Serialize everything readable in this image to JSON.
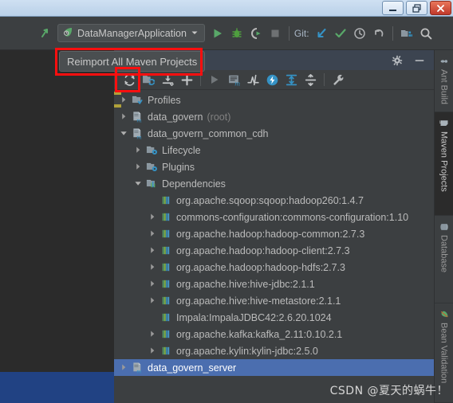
{
  "window": {
    "controls": [
      {
        "name": "minimize-button",
        "glyph": "minimize"
      },
      {
        "name": "restore-button",
        "glyph": "restore"
      },
      {
        "name": "close-button",
        "glyph": "close"
      }
    ]
  },
  "main_toolbar": {
    "back_icon": "back-arrow-icon",
    "run_config": {
      "label": "DataManagerApplication",
      "icon": "spring-boot-icon",
      "dropdown_icon": "chevron-down-icon"
    },
    "actions": [
      {
        "name": "run-button",
        "icon": "run-icon",
        "color": "#5a9e4b"
      },
      {
        "name": "debug-button",
        "icon": "debug-icon",
        "color": "#4f9e3f"
      },
      {
        "name": "run-coverage-button",
        "icon": "coverage-icon",
        "color": "#b8b8b8"
      },
      {
        "name": "stop-button",
        "icon": "stop-icon",
        "color": "#6e7173"
      }
    ],
    "git_label": "Git:",
    "git_actions": [
      {
        "name": "update-project-button",
        "icon": "update-arrow-icon",
        "color": "#3592c4"
      },
      {
        "name": "commit-button",
        "icon": "check-icon",
        "color": "#59a869"
      },
      {
        "name": "history-button",
        "icon": "clock-icon",
        "color": "#afb1b3"
      },
      {
        "name": "rollback-button",
        "icon": "undo-icon",
        "color": "#afb1b3"
      }
    ],
    "right_actions": [
      {
        "name": "project-structure-button",
        "icon": "project-structure-icon"
      },
      {
        "name": "search-everywhere-button",
        "icon": "search-icon"
      }
    ]
  },
  "tooltip": {
    "text": "Reimport All Maven Projects"
  },
  "tool_window": {
    "header_actions": [
      {
        "name": "settings-button",
        "icon": "gear-icon"
      },
      {
        "name": "hide-button",
        "icon": "minimize-dash-icon"
      }
    ],
    "toolbar": [
      {
        "name": "reimport-all-maven-projects-button",
        "icon": "reimport-icon",
        "active": true
      },
      {
        "name": "generate-sources-button",
        "icon": "generate-sources-icon"
      },
      {
        "name": "download-sources-button",
        "icon": "download-icon"
      },
      {
        "name": "add-maven-project-button",
        "icon": "plus-icon"
      },
      {
        "name": "run-build-button",
        "icon": "run-icon"
      },
      {
        "name": "execute-maven-goal-button",
        "icon": "execute-goal-icon"
      },
      {
        "name": "toggle-skip-tests-button",
        "icon": "skip-tests-icon"
      },
      {
        "name": "toggle-offline-mode-button",
        "icon": "offline-icon"
      },
      {
        "name": "expand-all-button",
        "icon": "expand-all-icon"
      },
      {
        "name": "collapse-all-button",
        "icon": "collapse-all-icon"
      },
      {
        "name": "maven-settings-button",
        "icon": "wrench-icon"
      }
    ],
    "tree": [
      {
        "label": "Profiles",
        "sub": "",
        "indent": 0,
        "arrow": "collapsed",
        "icon": "profiles-folder-icon",
        "selected": false
      },
      {
        "label": "data_govern",
        "sub": "(root)",
        "indent": 0,
        "arrow": "collapsed",
        "icon": "maven-module-icon",
        "selected": false
      },
      {
        "label": "data_govern_common_cdh",
        "sub": "",
        "indent": 0,
        "arrow": "expanded",
        "icon": "maven-module-icon",
        "selected": false
      },
      {
        "label": "Lifecycle",
        "sub": "",
        "indent": 1,
        "arrow": "collapsed",
        "icon": "lifecycle-folder-icon",
        "selected": false
      },
      {
        "label": "Plugins",
        "sub": "",
        "indent": 1,
        "arrow": "collapsed",
        "icon": "plugins-folder-icon",
        "selected": false
      },
      {
        "label": "Dependencies",
        "sub": "",
        "indent": 1,
        "arrow": "expanded",
        "icon": "dependencies-folder-icon",
        "selected": false
      },
      {
        "label": "org.apache.sqoop:sqoop:hadoop260:1.4.7",
        "sub": "",
        "indent": 2,
        "arrow": "none",
        "icon": "library-icon",
        "selected": false
      },
      {
        "label": "commons-configuration:commons-configuration:1.10",
        "sub": "",
        "indent": 2,
        "arrow": "collapsed",
        "icon": "library-icon",
        "selected": false
      },
      {
        "label": "org.apache.hadoop:hadoop-common:2.7.3",
        "sub": "",
        "indent": 2,
        "arrow": "collapsed",
        "icon": "library-icon",
        "selected": false
      },
      {
        "label": "org.apache.hadoop:hadoop-client:2.7.3",
        "sub": "",
        "indent": 2,
        "arrow": "collapsed",
        "icon": "library-icon",
        "selected": false
      },
      {
        "label": "org.apache.hadoop:hadoop-hdfs:2.7.3",
        "sub": "",
        "indent": 2,
        "arrow": "collapsed",
        "icon": "library-icon",
        "selected": false
      },
      {
        "label": "org.apache.hive:hive-jdbc:2.1.1",
        "sub": "",
        "indent": 2,
        "arrow": "collapsed",
        "icon": "library-icon",
        "selected": false
      },
      {
        "label": "org.apache.hive:hive-metastore:2.1.1",
        "sub": "",
        "indent": 2,
        "arrow": "collapsed",
        "icon": "library-icon",
        "selected": false
      },
      {
        "label": "Impala:ImpalaJDBC42:2.6.20.1024",
        "sub": "",
        "indent": 2,
        "arrow": "none",
        "icon": "library-icon",
        "selected": false
      },
      {
        "label": "org.apache.kafka:kafka_2.11:0.10.2.1",
        "sub": "",
        "indent": 2,
        "arrow": "collapsed",
        "icon": "library-icon",
        "selected": false
      },
      {
        "label": "org.apache.kylin:kylin-jdbc:2.5.0",
        "sub": "",
        "indent": 2,
        "arrow": "collapsed",
        "icon": "library-icon",
        "selected": false
      },
      {
        "label": "data_govern_server",
        "sub": "",
        "indent": 0,
        "arrow": "collapsed",
        "icon": "maven-module-icon",
        "selected": true
      }
    ]
  },
  "sidebar": {
    "tabs": [
      {
        "label": "Ant Build",
        "icon": "ant-icon",
        "active": false
      },
      {
        "label": "Maven Projects",
        "icon": "maven-icon",
        "active": true
      },
      {
        "label": "Database",
        "icon": "database-icon",
        "active": false
      },
      {
        "label": "Bean Validation",
        "icon": "bean-validation-icon",
        "active": false
      }
    ]
  },
  "watermark": {
    "text": "CSDN @夏天的蜗牛！"
  },
  "colors": {
    "panel_bg": "#3c3f41",
    "editor_bg": "#2b2b2b",
    "header_bg": "#3c4450",
    "selection_blue": "#4b6eaf",
    "editor_selection": "#214283",
    "annotation_red": "#fb0f0f",
    "accent_green": "#59a869",
    "accent_blue": "#3592c4"
  }
}
